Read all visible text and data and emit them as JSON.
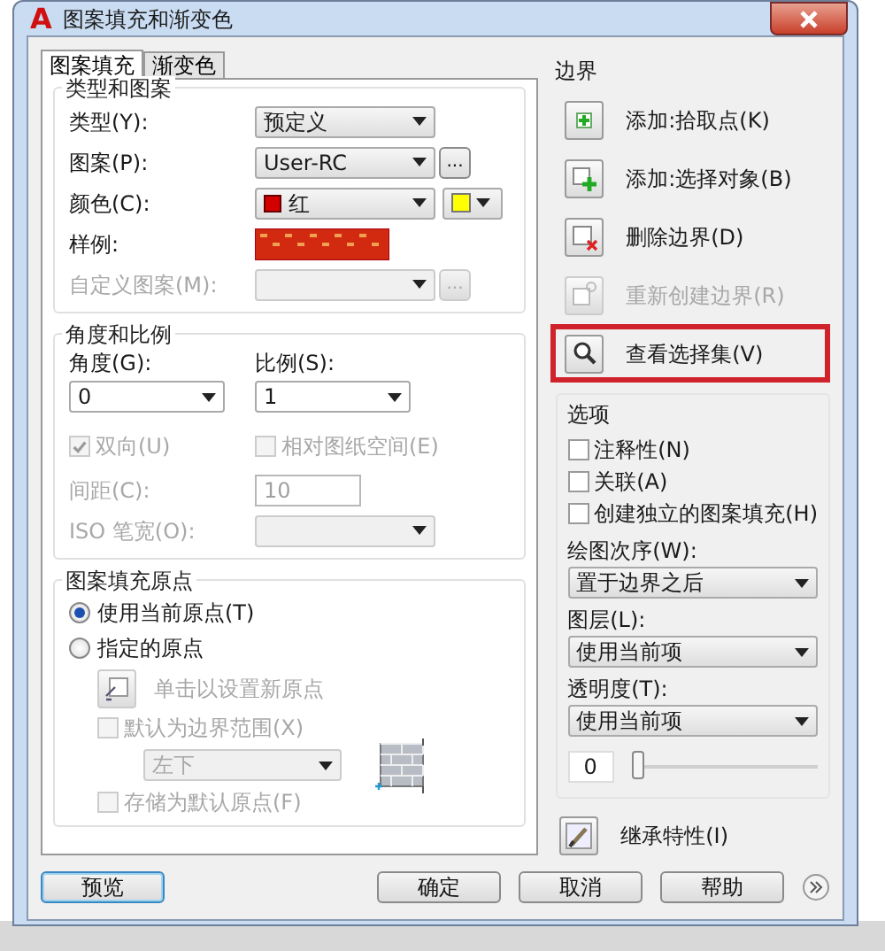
{
  "window": {
    "logo": "A",
    "title": "图案填充和渐变色"
  },
  "tabs": [
    {
      "label": "图案填充",
      "selected": true
    },
    {
      "label": "渐变色",
      "selected": false
    }
  ],
  "type_and_pattern": {
    "title": "类型和图案",
    "type": {
      "label": "类型(Y):",
      "value": "预定义"
    },
    "pattern": {
      "label": "图案(P):",
      "value": "User-RC",
      "browse": "..."
    },
    "color": {
      "label": "颜色(C):",
      "value": "红",
      "color": "#d40000",
      "background": {
        "color": "#ffff00"
      }
    },
    "sample": {
      "label": "样例:"
    },
    "custom": {
      "label": "自定义图案(M):",
      "browse": "...",
      "disabled": true
    }
  },
  "angle_and_scale": {
    "title": "角度和比例",
    "angle": {
      "label": "角度(G):",
      "value": "0"
    },
    "scale": {
      "label": "比例(S):",
      "value": "1"
    },
    "double": {
      "label": "双向(U)",
      "checked": true,
      "disabled": true
    },
    "relative": {
      "label": "相对图纸空间(E)",
      "checked": false,
      "disabled": true
    },
    "spacing": {
      "label": "间距(C):",
      "value": "10",
      "disabled": true
    },
    "iso_pen": {
      "label": "ISO 笔宽(O):",
      "disabled": true
    }
  },
  "origin": {
    "title": "图案填充原点",
    "options": [
      {
        "label": "使用当前原点(T)",
        "selected": true
      },
      {
        "label": "指定的原点",
        "selected": false
      }
    ],
    "click_set": {
      "label": "单击以设置新原点",
      "disabled": true
    },
    "default_extent": {
      "label": "默认为边界范围(X)",
      "checked": false,
      "disabled": true
    },
    "extent_position": {
      "value": "左下",
      "disabled": true
    },
    "store_default": {
      "label": "存储为默认原点(F)",
      "checked": false,
      "disabled": true
    }
  },
  "boundaries": {
    "title": "边界",
    "items": [
      {
        "kind": "pick",
        "label": "添加:拾取点(K)",
        "disabled": false,
        "highlighted": false
      },
      {
        "kind": "select",
        "label": "添加:选择对象(B)",
        "disabled": false,
        "highlighted": false
      },
      {
        "kind": "remove",
        "label": "删除边界(D)",
        "disabled": false,
        "highlighted": false
      },
      {
        "kind": "recreate",
        "label": "重新创建边界(R)",
        "disabled": true,
        "highlighted": false
      },
      {
        "kind": "view",
        "label": "查看选择集(V)",
        "disabled": false,
        "highlighted": true
      }
    ]
  },
  "options": {
    "title": "选项",
    "checkboxes": [
      {
        "label": "注释性(N)",
        "checked": false
      },
      {
        "label": "关联(A)",
        "checked": false
      },
      {
        "label": "创建独立的图案填充(H)",
        "checked": false
      }
    ],
    "draw_order": {
      "label": "绘图次序(W):",
      "value": "置于边界之后"
    },
    "layer": {
      "label": "图层(L):",
      "value": "使用当前项"
    },
    "transparency": {
      "label": "透明度(T):",
      "value": "使用当前项",
      "reading": "0",
      "level": 0
    }
  },
  "inherit": {
    "label": "继承特性(I)"
  },
  "buttons": [
    {
      "label": "预览",
      "default": true
    },
    {
      "label": "确定",
      "default": false
    },
    {
      "label": "取消",
      "default": false
    },
    {
      "label": "帮助",
      "default": false
    }
  ]
}
